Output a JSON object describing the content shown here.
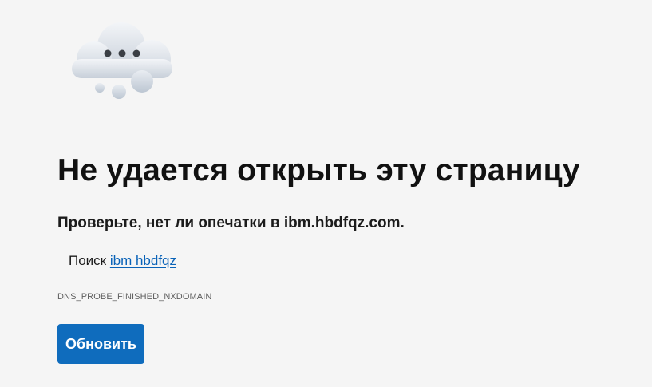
{
  "error_page": {
    "illustration_icon": "cloud-offline-icon",
    "heading": "Не удается открыть эту страницу",
    "subtitle": "Проверьте, нет ли опечатки в ibm.hbdfqz.com.",
    "search_prefix": "Поиск",
    "search_query": "ibm hbdfqz",
    "error_code": "DNS_PROBE_FINISHED_NXDOMAIN",
    "reload_label": "Обновить"
  },
  "colors": {
    "background": "#f5f5f5",
    "accent": "#0f6cbd",
    "link": "#0a63b8",
    "text": "#1b1b1b"
  }
}
